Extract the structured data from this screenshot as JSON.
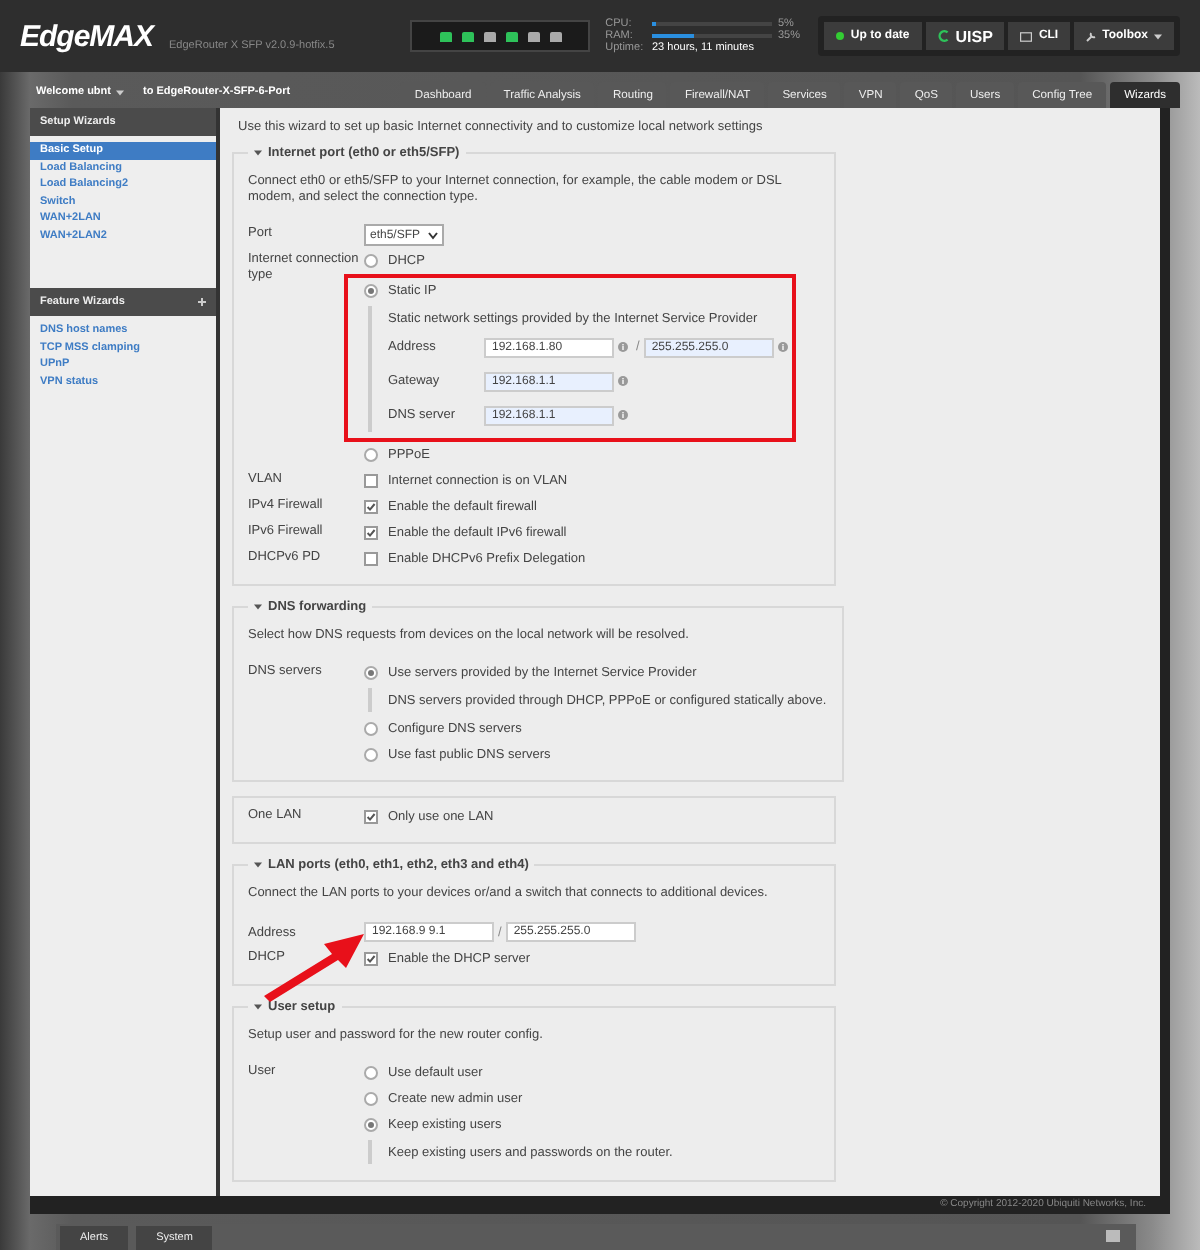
{
  "header": {
    "logo": "EdgeMAX",
    "subtitle": "EdgeRouter X SFP v2.0.9-hotfix.5",
    "ports": [
      {
        "up": true
      },
      {
        "up": true
      },
      {
        "up": false
      },
      {
        "up": true
      },
      {
        "up": false
      },
      {
        "up": false
      }
    ],
    "meters": [
      {
        "label": "CPU:",
        "level": 0.03,
        "reading": "5%"
      },
      {
        "label": "RAM:",
        "level": 0.35,
        "reading": "35%"
      }
    ],
    "uptime": {
      "label": "Uptime:",
      "value": "23 hours, 11 minutes"
    },
    "buttons": [
      {
        "kind": "status",
        "label": "Up to date"
      },
      {
        "kind": "uisp",
        "label": "UISP"
      },
      {
        "kind": "cli",
        "label": "CLI"
      },
      {
        "kind": "toolbox",
        "label": "Toolbox"
      }
    ]
  },
  "nav": {
    "welcome": "Welcome ubnt",
    "device": "to EdgeRouter-X-SFP-6-Port",
    "tabs": [
      {
        "label": "Dashboard",
        "selected": false
      },
      {
        "label": "Traffic Analysis",
        "selected": false
      },
      {
        "label": "Routing",
        "selected": false
      },
      {
        "label": "Firewall/NAT",
        "selected": false
      },
      {
        "label": "Services",
        "selected": false
      },
      {
        "label": "VPN",
        "selected": false
      },
      {
        "label": "QoS",
        "selected": false
      },
      {
        "label": "Users",
        "selected": false
      },
      {
        "label": "Config Tree",
        "selected": false
      },
      {
        "label": "Wizards",
        "selected": true
      }
    ]
  },
  "sidebar": [
    {
      "title": "Setup Wizards",
      "collapsible": false,
      "items": [
        {
          "label": "Basic Setup",
          "selected": true
        },
        {
          "label": "Load Balancing",
          "selected": false
        },
        {
          "label": "Load Balancing2",
          "selected": false
        },
        {
          "label": "Switch",
          "selected": false
        },
        {
          "label": "WAN+2LAN",
          "selected": false
        },
        {
          "label": "WAN+2LAN2",
          "selected": false
        }
      ]
    },
    {
      "title": "Feature Wizards",
      "collapsible": true,
      "items": [
        {
          "label": "DNS host names",
          "selected": false
        },
        {
          "label": "TCP MSS clamping",
          "selected": false
        },
        {
          "label": "UPnP",
          "selected": false
        },
        {
          "label": "VPN status",
          "selected": false
        }
      ]
    }
  ],
  "content": {
    "intro": "Use this wizard to set up basic Internet connectivity and to customize local network settings",
    "sections": [
      {
        "legend": "Internet port (eth0 or eth5/SFP)",
        "description": "Connect eth0 or eth5/SFP to your Internet connection, for example, the cable modem or DSL modem, and select the connection type.",
        "rows": [
          {
            "kind": "select",
            "label": "Port",
            "value": "eth5/SFP"
          },
          {
            "kind": "radios",
            "label": "Internet connection type",
            "options": [
              {
                "label": "DHCP",
                "selected": false
              },
              {
                "label": "Static IP",
                "selected": true,
                "highlighted": true,
                "note": "Static network settings provided by the Internet Service Provider",
                "fields": [
                  {
                    "label": "Address",
                    "value": "192.168.1.80",
                    "separator": "/",
                    "mask": "255.255.255.0"
                  },
                  {
                    "label": "Gateway",
                    "value": "192.168.1.1"
                  },
                  {
                    "label": "DNS server",
                    "value": "192.168.1.1"
                  }
                ]
              },
              {
                "label": "PPPoE",
                "selected": false
              }
            ]
          },
          {
            "kind": "checkbox",
            "label": "VLAN",
            "text": "Internet connection is on VLAN",
            "checked": false
          },
          {
            "kind": "checkbox",
            "label": "IPv4 Firewall",
            "text": "Enable the default firewall",
            "checked": true
          },
          {
            "kind": "checkbox",
            "label": "IPv6 Firewall",
            "text": "Enable the default IPv6 firewall",
            "checked": true
          },
          {
            "kind": "checkbox",
            "label": "DHCPv6 PD",
            "text": "Enable DHCPv6 Prefix Delegation",
            "checked": false
          }
        ]
      },
      {
        "legend": "DNS forwarding",
        "description": "Select how DNS requests from devices on the local network will be resolved.",
        "rows": [
          {
            "kind": "radios",
            "label": "DNS servers",
            "options": [
              {
                "label": "Use servers provided by the Internet Service Provider",
                "selected": true,
                "note": "DNS servers provided through DHCP, PPPoE or configured statically above."
              },
              {
                "label": "Configure DNS servers",
                "selected": false
              },
              {
                "label": "Use fast public DNS servers",
                "selected": false
              }
            ]
          }
        ]
      },
      {
        "rows": [
          {
            "kind": "checkbox",
            "label": "One LAN",
            "text": "Only use one LAN",
            "checked": true
          }
        ]
      },
      {
        "legend": "LAN ports (eth0, eth1, eth2, eth3 and eth4)",
        "description": "Connect the LAN ports to your devices or/and a switch that connects to additional devices.",
        "rows": [
          {
            "kind": "address",
            "label": "Address",
            "value": "192.168.9 9.1",
            "separator": "/",
            "mask": "255.255.255.0",
            "arrow": true
          },
          {
            "kind": "checkbox",
            "label": "DHCP",
            "text": "Enable the DHCP server",
            "checked": true
          }
        ]
      },
      {
        "legend": "User setup",
        "description": "Setup user and password for the new router config.",
        "rows": [
          {
            "kind": "radios",
            "label": "User",
            "options": [
              {
                "label": "Use default user",
                "selected": false
              },
              {
                "label": "Create new admin user",
                "selected": false
              },
              {
                "label": "Keep existing users",
                "selected": true,
                "note": "Keep existing users and passwords on the router."
              }
            ]
          }
        ]
      }
    ]
  },
  "footer": {
    "copyright": "© Copyright 2012-2020 Ubiquiti Networks, Inc."
  },
  "bottom_bar": {
    "tabs": [
      "Alerts",
      "System"
    ]
  }
}
